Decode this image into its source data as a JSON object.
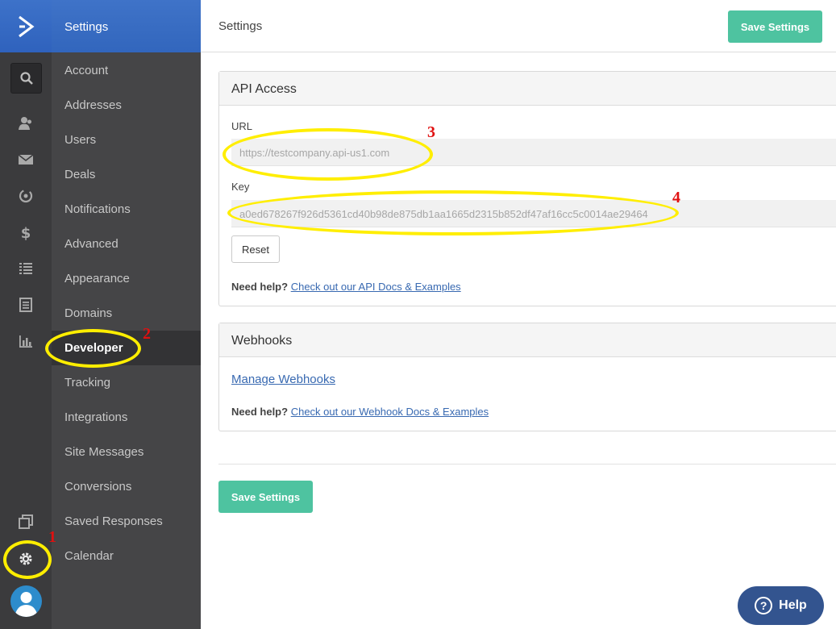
{
  "nav": {
    "header": "Settings",
    "items": [
      "Account",
      "Addresses",
      "Users",
      "Deals",
      "Notifications",
      "Advanced",
      "Appearance",
      "Domains",
      "Developer",
      "Tracking",
      "Integrations",
      "Site Messages",
      "Conversions",
      "Saved Responses",
      "Calendar"
    ],
    "active": "Developer"
  },
  "rail_icons": [
    "search-icon",
    "contacts-icon",
    "mail-icon",
    "automation-icon",
    "dollar-icon",
    "list-icon",
    "form-icon",
    "reports-icon",
    "pages-icon",
    "gear-icon",
    "avatar-icon"
  ],
  "topbar": {
    "title": "Settings",
    "save_label": "Save Settings"
  },
  "api_access": {
    "title": "API Access",
    "url_label": "URL",
    "url_value": "https://testcompany.api-us1.com",
    "key_label": "Key",
    "key_value": "a0ed678267f926d5361cd40b98de875db1aa1665d2315b852df47af16cc5c0014ae29464",
    "reset_label": "Reset",
    "help_prefix": "Need help?",
    "help_link": "Check out our API Docs & Examples"
  },
  "webhooks": {
    "title": "Webhooks",
    "manage_link": "Manage Webhooks",
    "help_prefix": "Need help?",
    "help_link": "Check out our Webhook Docs & Examples"
  },
  "footer": {
    "save_label": "Save Settings"
  },
  "help_button": {
    "label": "Help",
    "glyph": "?"
  },
  "annotations": [
    "1",
    "2",
    "3",
    "4"
  ],
  "colors": {
    "accent_green": "#4ec3a0",
    "brand_blue": "#356ae6",
    "highlight": "#ffee00",
    "annotation_red": "#e01010"
  }
}
